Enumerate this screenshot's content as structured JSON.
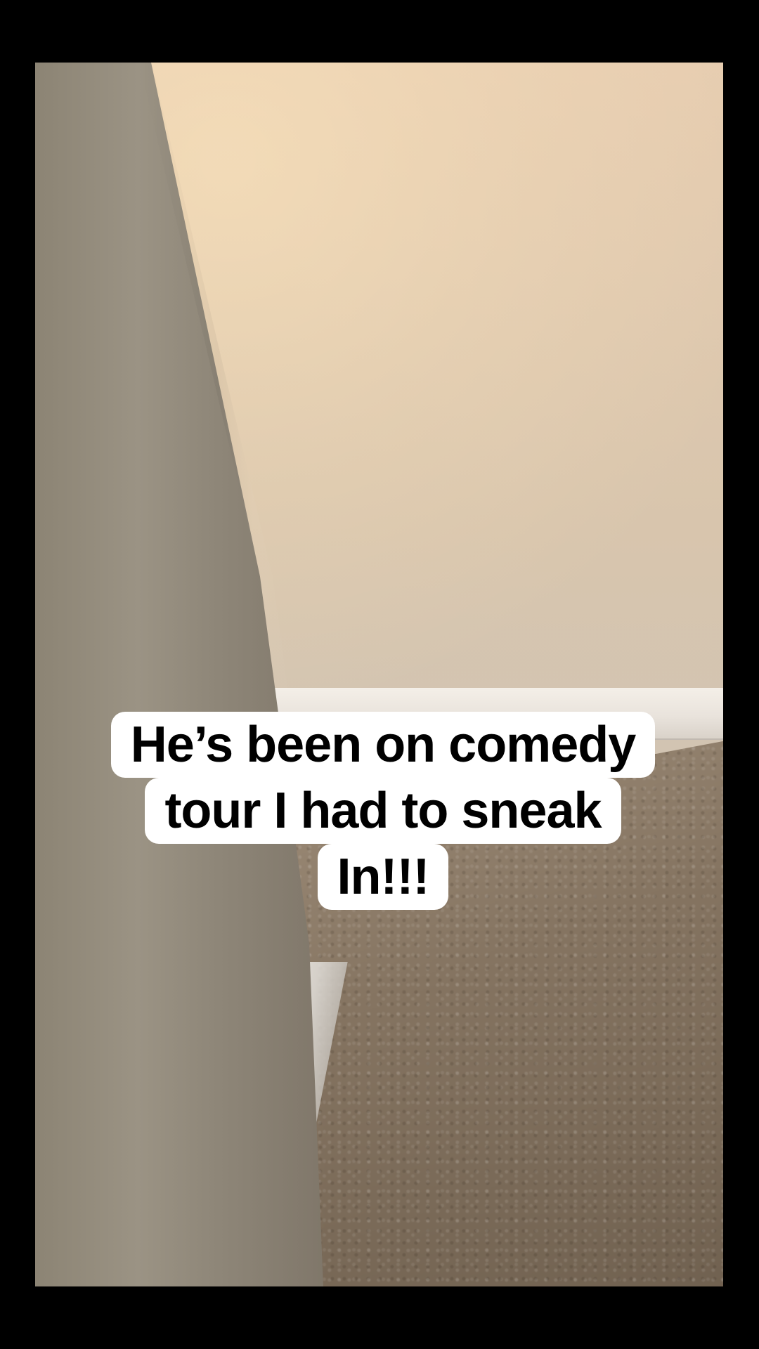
{
  "caption": {
    "line_1": "He’s been on comedy",
    "line_2": "tour I had to sneak",
    "line_3": "In!!!"
  },
  "colors": {
    "background": "#000000",
    "caption_background": "#ffffff",
    "caption_text": "#000000"
  }
}
